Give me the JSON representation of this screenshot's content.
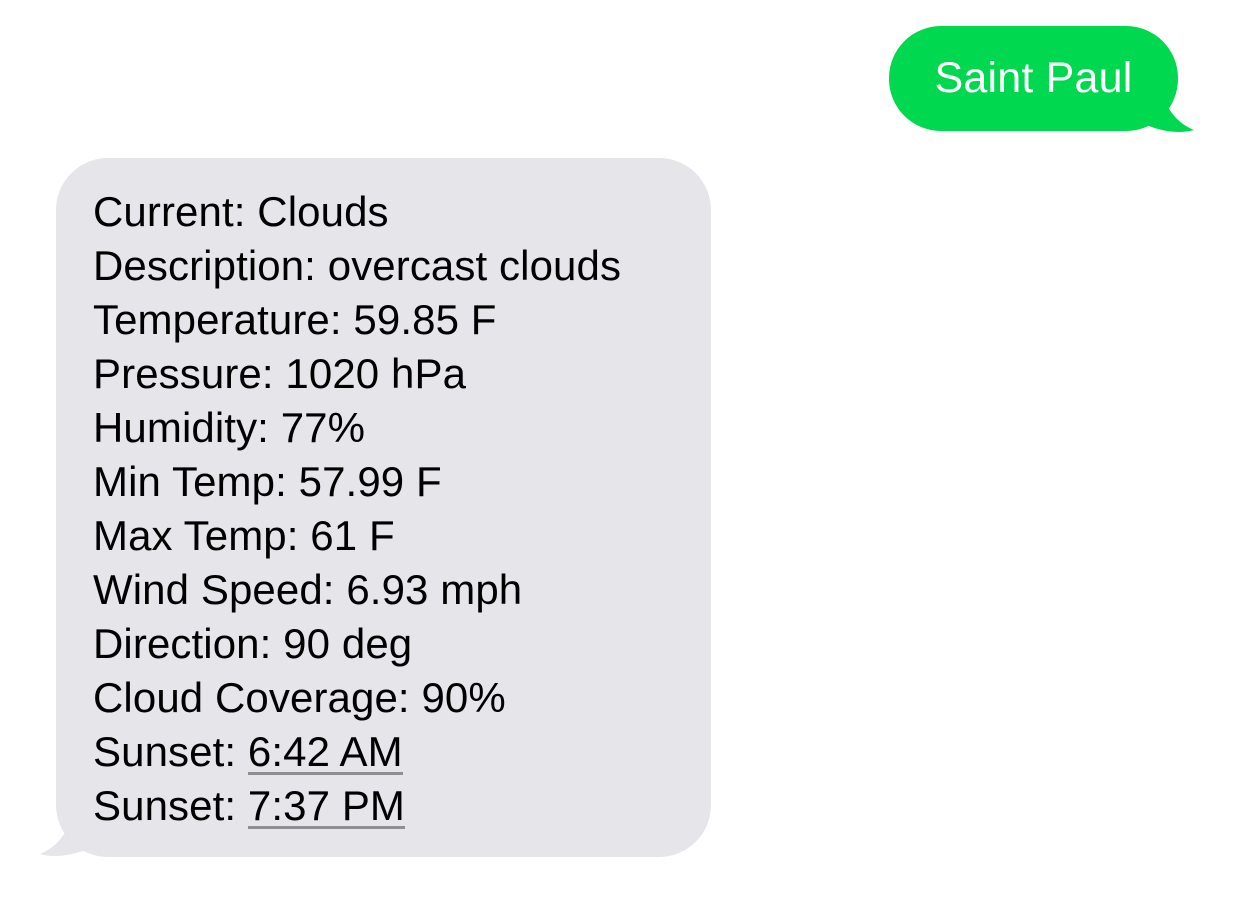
{
  "conversation": {
    "sent_message": {
      "text": "Saint Paul",
      "bubble_color": "#00d94f",
      "text_color": "#ffffff"
    },
    "received_message": {
      "bubble_color": "#e5e5ea",
      "text_color": "#000000",
      "lines": [
        {
          "label": "Current: ",
          "value": "Clouds"
        },
        {
          "label": "Description: ",
          "value": "overcast clouds"
        },
        {
          "label": "Temperature: ",
          "value": "59.85 F"
        },
        {
          "label": "Pressure: ",
          "value": "1020 hPa"
        },
        {
          "label": "Humidity: ",
          "value": "77%"
        },
        {
          "label": "Min Temp: ",
          "value": "57.99 F"
        },
        {
          "label": "Max Temp: ",
          "value": "61 F"
        },
        {
          "label": "Wind Speed: ",
          "value": "6.93 mph"
        },
        {
          "label": "Direction: ",
          "value": "90 deg"
        },
        {
          "label": "Cloud Coverage: ",
          "value": "90%"
        },
        {
          "label": "Sunset: ",
          "value": "6:42 AM",
          "link": true
        },
        {
          "label": "Sunset: ",
          "value": "7:37 PM",
          "link": true
        }
      ]
    }
  }
}
